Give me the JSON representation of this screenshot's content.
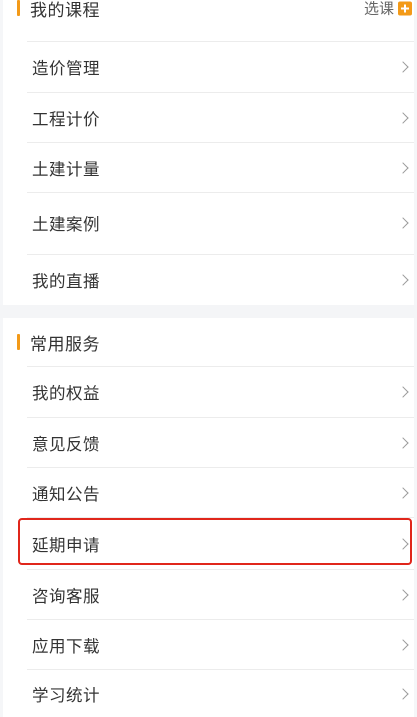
{
  "my_courses": {
    "title": "我的课程",
    "select_label": "选课",
    "items": [
      {
        "label": "造价管理"
      },
      {
        "label": "工程计价"
      },
      {
        "label": "土建计量"
      },
      {
        "label": "土建案例"
      },
      {
        "label": "我的直播"
      }
    ]
  },
  "services": {
    "title": "常用服务",
    "items": [
      {
        "label": "我的权益"
      },
      {
        "label": "意见反馈"
      },
      {
        "label": "通知公告"
      },
      {
        "label": "延期申请"
      },
      {
        "label": "咨询客服"
      },
      {
        "label": "应用下载"
      },
      {
        "label": "学习统计"
      }
    ]
  },
  "colors": {
    "accent": "#f39a18",
    "highlight": "#e0261b",
    "divider": "#ececec",
    "background_band": "#f4f5f7"
  }
}
